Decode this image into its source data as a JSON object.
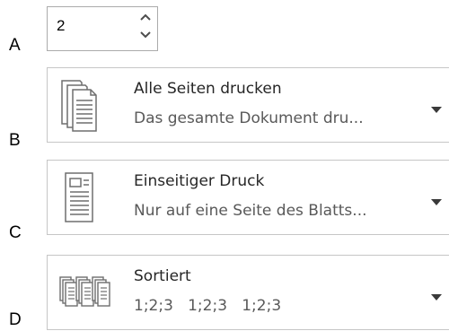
{
  "labels": {
    "a": "A",
    "b": "B",
    "c": "C",
    "d": "D"
  },
  "copies": {
    "value": "2"
  },
  "pages": {
    "title": "Alle Seiten drucken",
    "subtitle": "Das gesamte Dokument dru..."
  },
  "sides": {
    "title": "Einseitiger Druck",
    "subtitle": "Nur auf eine Seite des Blatts..."
  },
  "collation": {
    "title": "Sortiert",
    "subtitle": "1;2;3   1;2;3   1;2;3"
  },
  "icons": {
    "spin_up": "chevron-up-icon",
    "spin_down": "chevron-down-icon",
    "pages": "stacked-pages-icon",
    "sides": "single-sided-page-icon",
    "collation": "collated-pages-icon",
    "dropdown": "dropdown-arrow-icon"
  },
  "colors": {
    "border": "#c6c6c6",
    "icon_stroke": "#6e6e6e",
    "text": "#262626",
    "subtext": "#595959"
  }
}
